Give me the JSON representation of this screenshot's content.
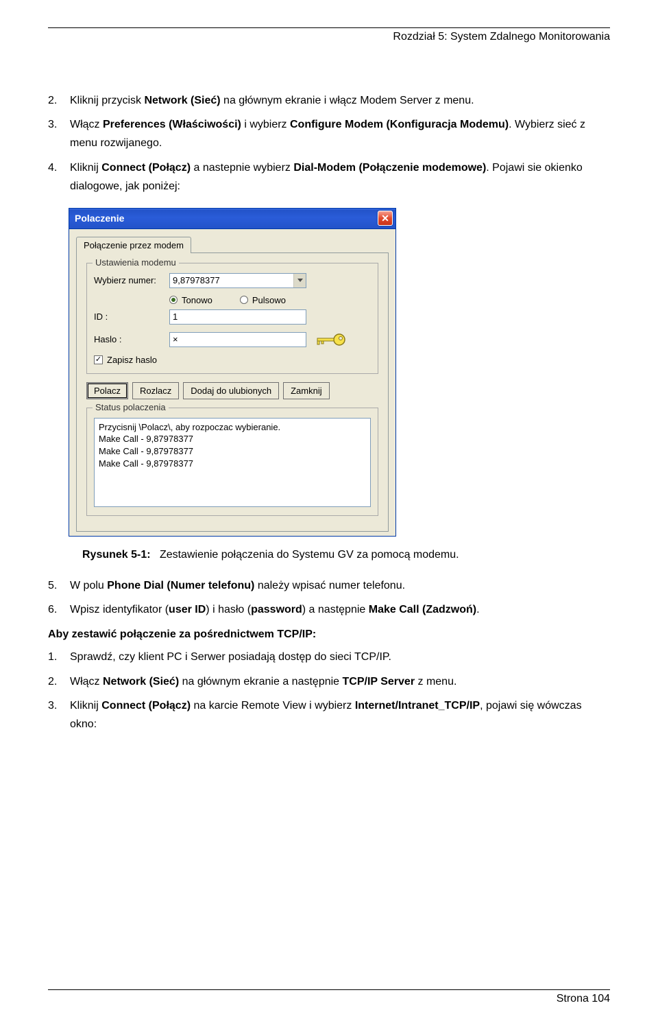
{
  "header": {
    "chapter": "Rozdział 5: System Zdalnego Monitorowania"
  },
  "stepsA": [
    {
      "num": "2.",
      "parts": [
        "Kliknij przycisk ",
        "Network (Sieć)",
        " na głównym ekranie i włącz Modem Server z menu."
      ]
    },
    {
      "num": "3.",
      "parts": [
        "Włącz ",
        "Preferences (Właściwości)",
        " i wybierz ",
        "Configure Modem (Konfiguracja Modemu)",
        ". Wybierz sieć z menu rozwijanego."
      ]
    },
    {
      "num": "4.",
      "parts": [
        "Kliknij ",
        "Connect (Połącz)",
        " a nastepnie wybierz ",
        "Dial-Modem (Połączenie modemowe)",
        ". Pojawi sie okienko dialogowe, jak poniżej:"
      ]
    }
  ],
  "dialog": {
    "title": "Polaczenie",
    "tab": "Połączenie przez modem",
    "group_title": "Ustawienia modemu",
    "number_label": "Wybierz numer:",
    "number_value": "9,87978377",
    "radio_tone": "Tonowo",
    "radio_pulse": "Pulsowo",
    "id_label": "ID :",
    "id_value": "1",
    "pw_label": "Haslo :",
    "pw_value": "×",
    "save_pw": "Zapisz haslo",
    "btn_connect": "Polacz",
    "btn_disconnect": "Rozlacz",
    "btn_addfav": "Dodaj do ulubionych",
    "btn_close": "Zamknij",
    "status_title": "Status polaczenia",
    "status_lines": "Przycisnij \\Polacz\\, aby rozpoczac wybieranie.\nMake Call - 9,87978377\nMake Call - 9,87978377\nMake Call - 9,87978377"
  },
  "figure": {
    "label": "Rysunek 5-1:",
    "caption": "Zestawienie połączenia do Systemu GV za pomocą modemu."
  },
  "stepsB": [
    {
      "num": "5.",
      "parts": [
        "W polu ",
        "Phone Dial (Numer telefonu)",
        " należy wpisać numer telefonu."
      ]
    },
    {
      "num": "6.",
      "parts": [
        "Wpisz identyfikator (",
        "user ID",
        ") i hasło (",
        "password",
        ") a następnie ",
        "Make Call (Zadzwoń)",
        "."
      ]
    }
  ],
  "section2": {
    "heading": "Aby zestawić połączenie za pośrednictwem TCP/IP:"
  },
  "stepsC": [
    {
      "num": "1.",
      "parts": [
        "Sprawdź, czy klient PC i Serwer posiadają dostęp do sieci TCP/IP."
      ]
    },
    {
      "num": "2.",
      "parts": [
        "Włącz ",
        "Network (Sieć)",
        " na głównym ekranie a następnie ",
        "TCP/IP Server",
        " z menu."
      ]
    },
    {
      "num": "3.",
      "parts": [
        "Kliknij ",
        "Connect (Połącz)",
        " na karcie Remote View i wybierz ",
        "Internet/Intranet_TCP/IP",
        ", pojawi się wówczas okno:"
      ]
    }
  ],
  "footer": {
    "page": "Strona 104"
  }
}
